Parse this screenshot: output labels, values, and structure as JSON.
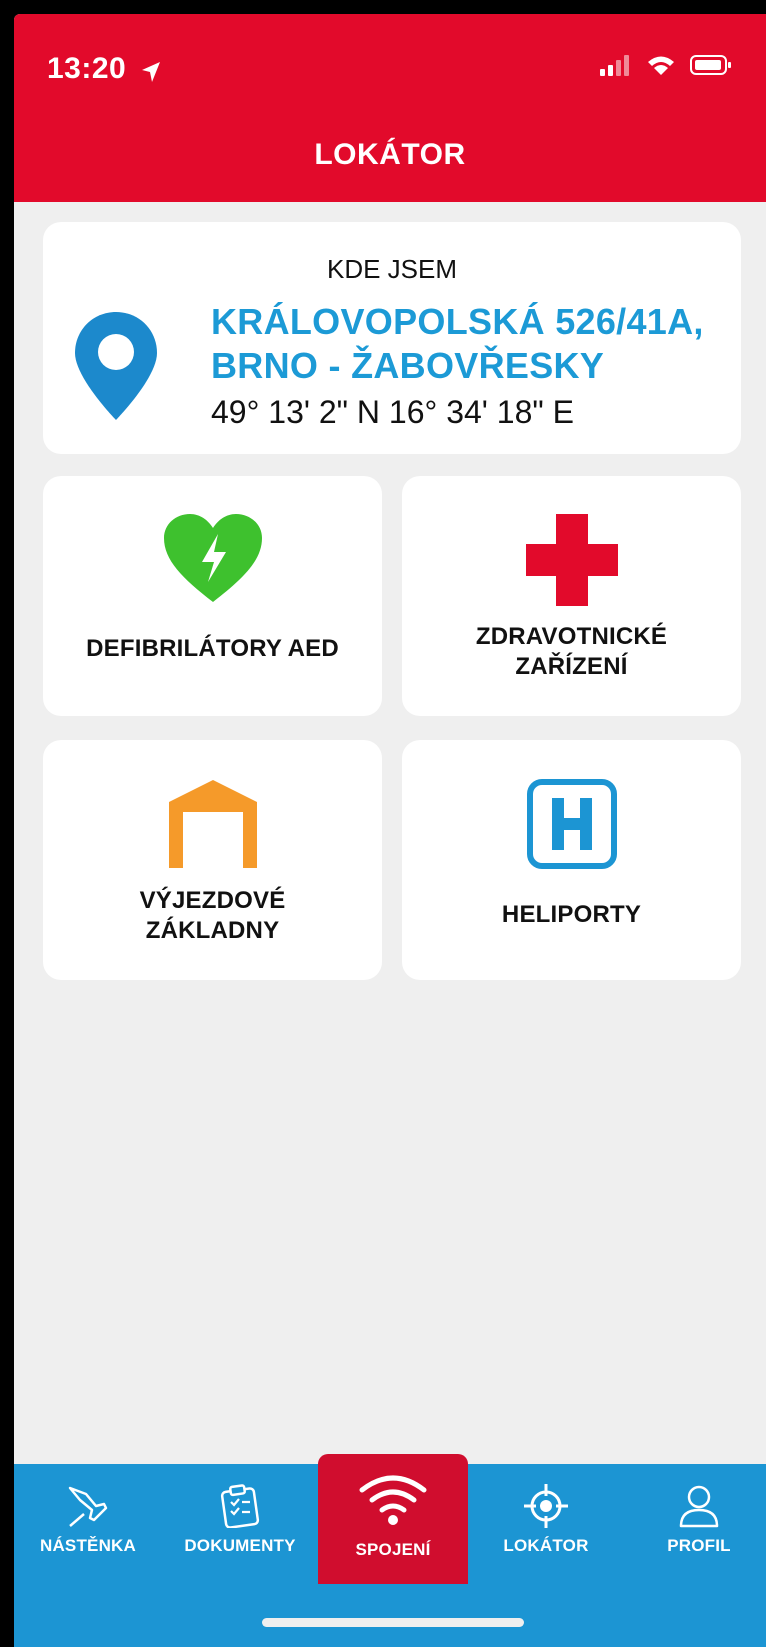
{
  "status_bar": {
    "time": "13:20"
  },
  "header": {
    "title": "LOKÁTOR"
  },
  "location": {
    "label": "KDE JSEM",
    "address_line1": "KRÁLOVOPOLSKÁ 526/41A,",
    "address_line2": "BRNO - ŽABOVŘESKY",
    "coordinates": "49° 13' 2\" N 16° 34' 18\" E"
  },
  "tiles": {
    "aed": {
      "label": "DEFIBRILÁTORY AED",
      "icon": "heart-defibrillator-icon",
      "color": "#3ec12e"
    },
    "medical": {
      "label_line1": "ZDRAVOTNICKÉ",
      "label_line2": "ZAŘÍZENÍ",
      "icon": "red-cross-icon",
      "color": "#e20a2b"
    },
    "stations": {
      "label_line1": "VÝJEZDOVÉ",
      "label_line2": "ZÁKLADNY",
      "icon": "garage-icon",
      "color": "#f59a2a"
    },
    "heliports": {
      "label": "HELIPORTY",
      "icon": "helipad-h-icon",
      "color": "#1c95d3"
    }
  },
  "tabbar": {
    "items": [
      {
        "label": "NÁSTĚNKA",
        "icon": "pin-icon"
      },
      {
        "label": "DOKUMENTY",
        "icon": "clipboard-icon"
      },
      {
        "label": "SPOJENÍ",
        "icon": "wifi-icon",
        "active": true
      },
      {
        "label": "LOKÁTOR",
        "icon": "crosshair-icon"
      },
      {
        "label": "PROFIL",
        "icon": "user-icon"
      }
    ]
  },
  "colors": {
    "brand_red": "#e20a2b",
    "brand_blue": "#1c95d3",
    "background": "#efefef"
  }
}
